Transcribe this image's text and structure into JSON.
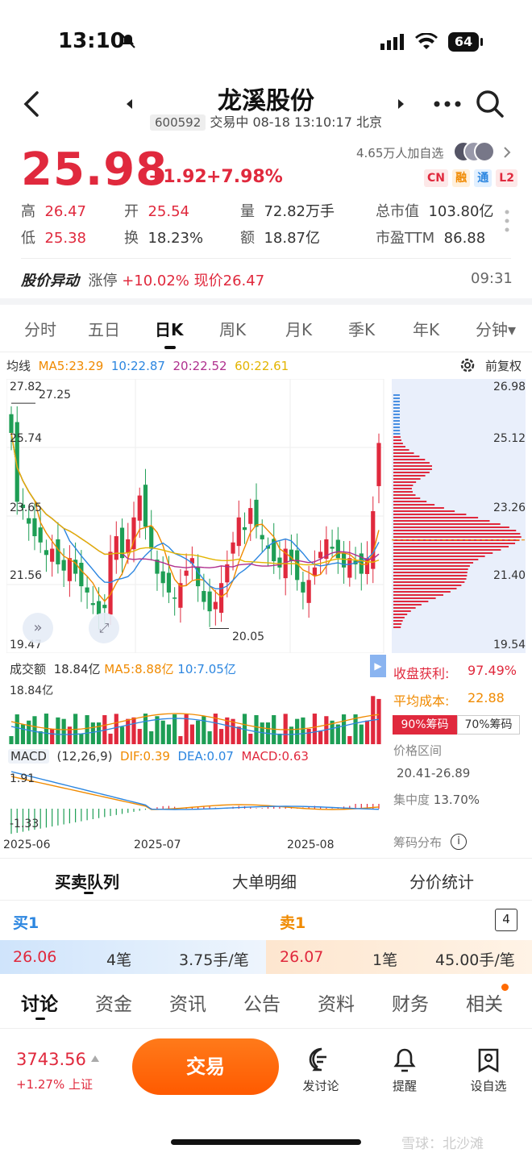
{
  "status": {
    "time": "13:10",
    "battery": "64"
  },
  "header": {
    "title": "龙溪股份",
    "code": "600592",
    "trade_status": "交易中 08-18 13:10:17 北京"
  },
  "quote": {
    "price": "25.98",
    "change": "+1.92",
    "change_pct": "+7.98%",
    "watchers": "4.65万人加自选",
    "badges": [
      "CN",
      "融",
      "通",
      "L2"
    ],
    "high_label": "高",
    "high": "26.47",
    "open_label": "开",
    "open": "25.54",
    "volume_label": "量",
    "volume": "72.82万手",
    "mktcap_label": "总市值",
    "mktcap": "103.80亿",
    "low_label": "低",
    "low": "25.38",
    "turnover_label": "换",
    "turnover": "18.23%",
    "amount_label": "额",
    "amount": "18.87亿",
    "pe_label": "市盈TTM",
    "pe": "86.88"
  },
  "alert": {
    "title": "股价异动",
    "type": "涨停",
    "pct": "+10.02%",
    "now": "现价26.47",
    "time": "09:31"
  },
  "period_tabs": [
    "分时",
    "五日",
    "日K",
    "周K",
    "月K",
    "季K",
    "年K",
    "分钟▾"
  ],
  "active_period": "日K",
  "ma_legend": {
    "label": "均线",
    "ma5": "MA5:23.29",
    "ma10": "10:22.87",
    "ma20": "20:22.52",
    "ma60": "60:22.61",
    "fq": "前复权"
  },
  "price_axis": {
    "p1": "27.82",
    "p2": "25.74",
    "p3": "23.65",
    "p4": "21.56",
    "p5": "19.47",
    "hi_mark": "27.25",
    "lo_mark": "20.05"
  },
  "chip_axis": {
    "a1": "26.98",
    "a2": "25.12",
    "a3": "23.26",
    "a4": "21.40",
    "a5": "19.54"
  },
  "volume_legend": {
    "label": "成交额",
    "value": "18.84亿",
    "ma5": "MA5:8.88亿",
    "ma10": "10:7.05亿",
    "max": "18.84亿"
  },
  "macd_legend": {
    "label": "MACD",
    "params": "(12,26,9)",
    "dif": "DIF:0.39",
    "dea": "DEA:0.07",
    "macd": "MACD:0.63",
    "top": "1.91",
    "bottom": "-1.33"
  },
  "x_axis": {
    "d1": "2025-06",
    "d2": "2025-07",
    "d3": "2025-08"
  },
  "chips": {
    "profit_label": "收盘获利:",
    "profit": "97.49%",
    "cost_label": "平均成本:",
    "cost": "22.88",
    "tab90": "90%筹码",
    "tab70": "70%筹码",
    "range_label": "价格区间",
    "range": "20.41-26.89",
    "conc_label": "集中度",
    "conc": "13.70%",
    "dist_label": "筹码分布"
  },
  "order_tabs": [
    "买卖队列",
    "大单明细",
    "分价统计"
  ],
  "orderbook": {
    "buy_label": "买1",
    "sell_label": "卖1",
    "level": "4",
    "buy_price": "26.06",
    "buy_count": "4笔",
    "buy_avg": "3.75手/笔",
    "sell_price": "26.07",
    "sell_count": "1笔",
    "sell_avg": "45.00手/笔"
  },
  "content_tabs": [
    "讨论",
    "资金",
    "资讯",
    "公告",
    "资料",
    "财务",
    "相关"
  ],
  "bottom": {
    "index": "3743.56",
    "index_chg": "+1.27% 上证",
    "trade": "交易",
    "discuss": "发讨论",
    "remind": "提醒",
    "watch": "设自选",
    "watermark": "雪球：北沙滩"
  },
  "chart_data": {
    "type": "candlestick",
    "x": [
      "2025-06",
      "2025-07",
      "2025-08"
    ],
    "ylim": [
      19.47,
      27.82
    ],
    "closes": [
      26.3,
      24.1,
      23.9,
      23.4,
      23.0,
      22.8,
      22.4,
      22.6,
      22.1,
      21.9,
      22.3,
      21.8,
      21.4,
      21.2,
      20.8,
      20.5,
      20.7,
      22.5,
      23.0,
      22.3,
      22.9,
      23.6,
      24.3,
      23.3,
      22.6,
      21.8,
      21.5,
      21.2,
      21.0,
      21.5,
      21.9,
      22.3,
      21.4,
      20.9,
      20.6,
      20.9,
      21.5,
      22.1,
      22.8,
      23.6,
      23.2,
      23.9,
      23.3,
      22.9,
      22.6,
      22.2,
      22.0,
      22.6,
      22.2,
      21.6,
      21.2,
      21.6,
      22.0,
      22.5,
      22.9,
      22.6,
      22.3,
      22.0,
      22.3,
      22.1,
      21.8,
      22.3,
      23.8,
      25.98
    ],
    "ma5_last": 23.29,
    "ma10_last": 22.87,
    "ma20_last": 22.52,
    "ma60_last": 22.61,
    "high_mark": 27.25,
    "low_mark": 20.05
  }
}
